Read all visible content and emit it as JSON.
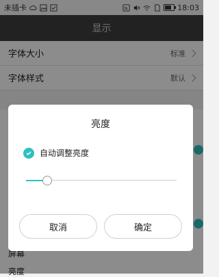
{
  "status_bar": {
    "carrier": "未插卡",
    "time": "18:03",
    "icons_left": [
      "cloud-icon",
      "image-icon",
      "check-box-icon"
    ],
    "icons_right": [
      "nfc-icon",
      "mute-icon",
      "wifi-icon",
      "sim-icon",
      "battery-icon"
    ],
    "battery_level_percent": 80
  },
  "app_bar": {
    "title": "显示"
  },
  "settings": {
    "rows": [
      {
        "label": "字体大小",
        "value": "标准"
      },
      {
        "label": "字体样式",
        "value": "默认"
      }
    ],
    "behind_overlay": [
      {
        "label": "屏幕"
      },
      {
        "label": "亮度"
      }
    ]
  },
  "dialog": {
    "title": "亮度",
    "auto_brightness_label": "自动调整亮度",
    "auto_brightness_checked": true,
    "slider_value_percent": 14,
    "cancel_label": "取消",
    "ok_label": "确定"
  },
  "colors": {
    "accent": "#2fbfbf",
    "app_bar": "#3f3f3f"
  }
}
